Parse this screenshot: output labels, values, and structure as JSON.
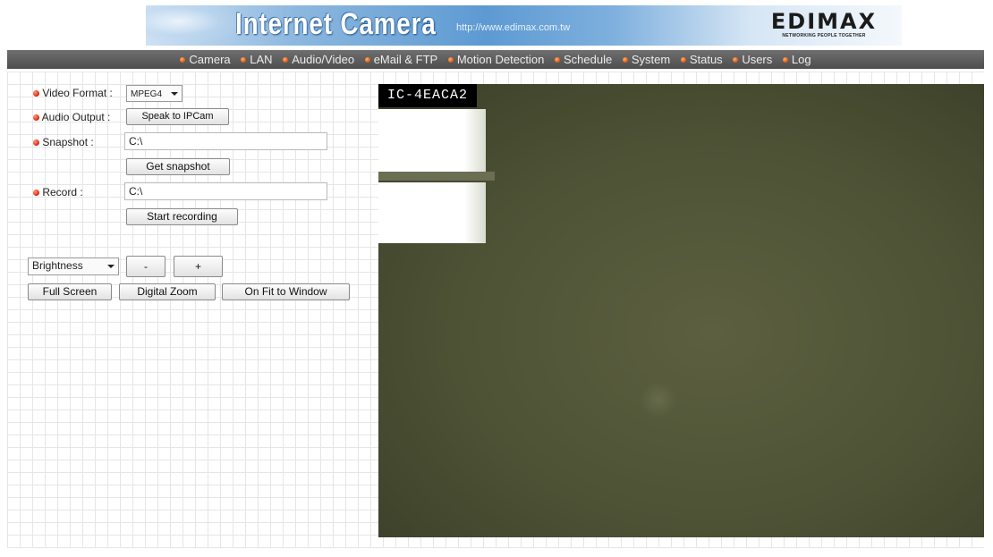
{
  "banner": {
    "title": "Internet Camera",
    "url": "http://www.edimax.com.tw",
    "logo_word": "EDIMAX",
    "logo_tagline": "NETWORKING PEOPLE TOGETHER"
  },
  "nav": {
    "items": [
      "Camera",
      "LAN",
      "Audio/Video",
      "eMail & FTP",
      "Motion Detection",
      "Schedule",
      "System",
      "Status",
      "Users",
      "Log"
    ]
  },
  "controls": {
    "video_format_label": "Video Format :",
    "video_format_value": "MPEG4",
    "audio_output_label": "Audio Output :",
    "speak_button": "Speak to IPCam",
    "snapshot_label": "Snapshot :",
    "snapshot_path": "C:\\",
    "get_snapshot_button": "Get snapshot",
    "record_label": "Record :",
    "record_path": "C:\\",
    "start_recording_button": "Start recording",
    "adjust_select_value": "Brightness",
    "minus_button": "-",
    "plus_button": "+",
    "full_screen_button": "Full Screen",
    "digital_zoom_button": "Digital Zoom",
    "fit_window_button": "On Fit to Window"
  },
  "video": {
    "camera_name": "IC-4EACA2"
  },
  "colors": {
    "nav_bg": "#5a5a5a",
    "bullet": "#e0560c",
    "label_dot": "#d61e0c"
  }
}
